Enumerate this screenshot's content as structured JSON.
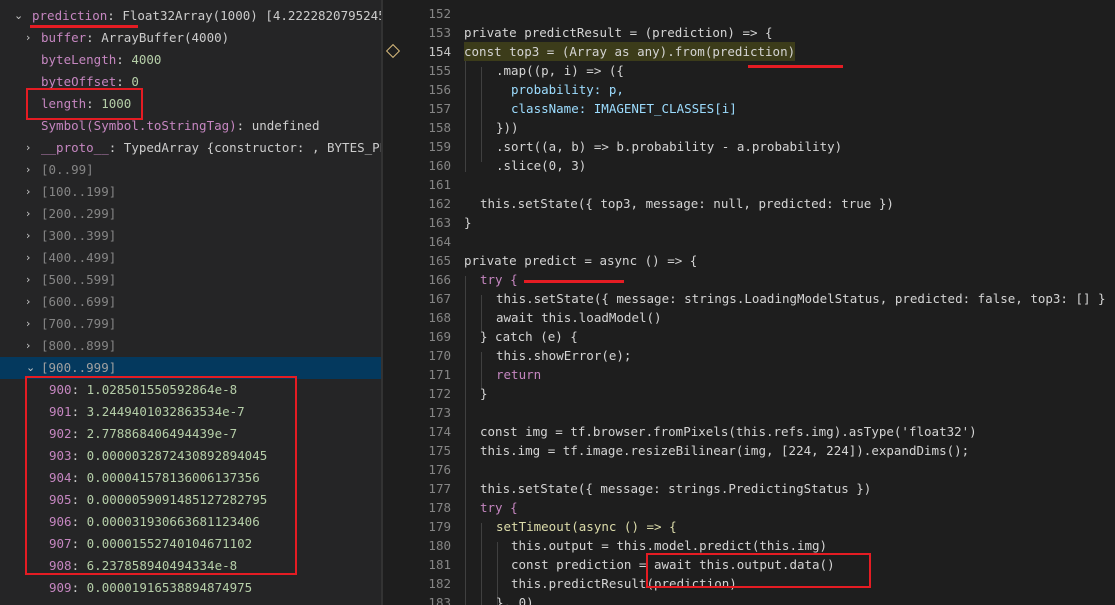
{
  "variables": {
    "prediction": {
      "name": "prediction",
      "type": "Float32Array(1000)",
      "preview": "[4.2222820795245…"
    },
    "props": [
      {
        "name": "buffer",
        "value": "ArrayBuffer(4000)"
      },
      {
        "name": "byteLength",
        "value": "4000"
      },
      {
        "name": "byteOffset",
        "value": "0"
      },
      {
        "name": "length",
        "value": "1000"
      },
      {
        "name": "Symbol(Symbol.toStringTag)",
        "value": "undefined"
      },
      {
        "name": "__proto__",
        "value": "TypedArray {constructor: , BYTES_PE…"
      }
    ],
    "ranges": [
      "[0..99]",
      "[100..199]",
      "[200..299]",
      "[300..399]",
      "[400..499]",
      "[500..599]",
      "[600..699]",
      "[700..799]",
      "[800..899]",
      "[900..999]"
    ],
    "entries": [
      {
        "index": "900",
        "value": "1.028501550592864e-8"
      },
      {
        "index": "901",
        "value": "3.2449401032863534e-7"
      },
      {
        "index": "902",
        "value": "2.778868406494439e-7"
      },
      {
        "index": "903",
        "value": "0.000003287243089289404​5"
      },
      {
        "index": "904",
        "value": "0.00004157813600613735​6"
      },
      {
        "index": "905",
        "value": "0.00000590914851272827​95"
      },
      {
        "index": "906",
        "value": "0.0000319306636811234​06"
      },
      {
        "index": "907",
        "value": "0.0000155274010467110​2"
      },
      {
        "index": "908",
        "value": "6.237858940494334e-8"
      },
      {
        "index": "909",
        "value": "0.00001916538894874975"
      }
    ]
  },
  "tooltip": "predictResult",
  "editor": {
    "line_numbers": [
      "152",
      "153",
      "154",
      "155",
      "156",
      "157",
      "158",
      "159",
      "160",
      "161",
      "162",
      "163",
      "164",
      "165",
      "166",
      "167",
      "168",
      "169",
      "170",
      "171",
      "172",
      "173",
      "174",
      "175",
      "176",
      "177",
      "178",
      "179",
      "180",
      "181",
      "182",
      "183"
    ],
    "current_line": "154",
    "lines": [
      {
        "n": "152",
        "t": ""
      },
      {
        "n": "153",
        "t": "private predictResult = (prediction) => {"
      },
      {
        "n": "154",
        "t": "const top3 = (Array as any).from(prediction)"
      },
      {
        "n": "155",
        "t": ".map((p, i) => ({"
      },
      {
        "n": "156",
        "t": "probability: p,"
      },
      {
        "n": "157",
        "t": "className: IMAGENET_CLASSES[i]"
      },
      {
        "n": "158",
        "t": "}))"
      },
      {
        "n": "159",
        "t": ".sort((a, b) => b.probability - a.probability)"
      },
      {
        "n": "160",
        "t": ".slice(0, 3)"
      },
      {
        "n": "161",
        "t": ""
      },
      {
        "n": "162",
        "t": "this.setState({ top3, message: null, predicted: true })"
      },
      {
        "n": "163",
        "t": "}"
      },
      {
        "n": "164",
        "t": ""
      },
      {
        "n": "165",
        "t": "private predict = async () => {"
      },
      {
        "n": "166",
        "t": "try {"
      },
      {
        "n": "167",
        "t": "this.setState({ message: strings.LoadingModelStatus, predicted: false, top3: [] }"
      },
      {
        "n": "168",
        "t": "await this.loadModel()"
      },
      {
        "n": "169",
        "t": "} catch (e) {"
      },
      {
        "n": "170",
        "t": "this.showError(e);"
      },
      {
        "n": "171",
        "t": "return"
      },
      {
        "n": "172",
        "t": "}"
      },
      {
        "n": "173",
        "t": ""
      },
      {
        "n": "174",
        "t": "const img = tf.browser.fromPixels(this.refs.img).asType('float32')"
      },
      {
        "n": "175",
        "t": "this.img = tf.image.resizeBilinear(img, [224, 224]).expandDims();"
      },
      {
        "n": "176",
        "t": ""
      },
      {
        "n": "177",
        "t": "this.setState({ message: strings.PredictingStatus })"
      },
      {
        "n": "178",
        "t": "try {"
      },
      {
        "n": "179",
        "t": "setTimeout(async () => {"
      },
      {
        "n": "180",
        "t": "this.output = this.model.predict(this.img)"
      },
      {
        "n": "181",
        "t": "const prediction = await this.output.data()"
      },
      {
        "n": "182",
        "t": "this.predictResult(prediction)"
      },
      {
        "n": "183",
        "t": "}, 0)"
      }
    ]
  }
}
